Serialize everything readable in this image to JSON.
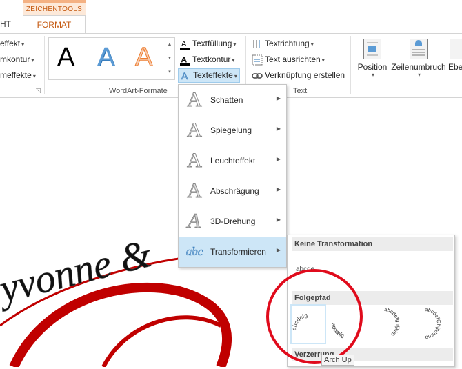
{
  "tabs": {
    "context_group": "ZEICHENTOOLS",
    "previous_tab": "HT",
    "active_tab": "FORMAT"
  },
  "ribbon": {
    "left_group_items": [
      "effekt",
      "mkontur",
      "meffekte"
    ],
    "wordart_group": {
      "label": "WordArt-Formate",
      "styles": [
        "A",
        "A",
        "A"
      ],
      "textfuellung": "Textfüllung",
      "textkontur": "Textkontur",
      "texteffekte": "Texteffekte"
    },
    "text_group": {
      "label": "Text",
      "textrichtung": "Textrichtung",
      "text_ausrichten": "Text ausrichten",
      "verknuepfung": "Verknüpfung erstellen"
    },
    "arrange": {
      "position": "Position",
      "zeilenumbruch": "Zeilenumbruch",
      "ebene": "Ebe"
    }
  },
  "document": {
    "wordart_text": "yvonne &"
  },
  "texteffekte_menu": [
    {
      "label": "Schatten"
    },
    {
      "label": "Spiegelung"
    },
    {
      "label": "Leuchteffekt"
    },
    {
      "label": "Abschrägung"
    },
    {
      "label": "3D-Drehung"
    },
    {
      "label": "Transformieren",
      "icon_text": "abc"
    }
  ],
  "transform_submenu": {
    "no_transform_header": "Keine Transformation",
    "no_transform_sample": "abcde",
    "folgepfad_header": "Folgepfad",
    "verzerrung_header": "Verzerrung",
    "arc_samples": [
      "abcdefg",
      "abcdefg",
      "abcdefghijklm",
      "abcdefGhijklmno"
    ],
    "tooltip": "Arch Up"
  },
  "colors": {
    "accent": "#c55a11",
    "menu_highlight": "#cde6f7",
    "annotation_red": "#e00b1c"
  }
}
